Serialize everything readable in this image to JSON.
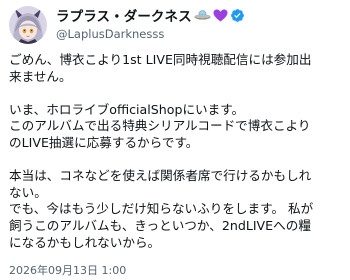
{
  "author": {
    "display_name": "ラプラス・ダークネス",
    "handle": "@LaplusDarknesss",
    "verified": true,
    "name_emojis": [
      "ufo-emoji",
      "purple-heart-emoji"
    ],
    "verified_color": "#1d9bf0"
  },
  "tweet": {
    "paragraphs": [
      "ごめん、博衣こより1st LIVE同時視聴配信には参加出\n来ません。",
      "いま、ホロライブofficialShopにいます。\nこのアルバムで出る特典シリアルコードで博衣こより\nのLIVE抽選に応募するからです。",
      "本当は、コネなどを使えば関係者席で行けるかもしれ\nない。\nでも、今はもう少しだけ知らないふりをします。 私が\n飼うこのアルバムも、きっといつか、2ndLIVEへの糧\nになるかもしれないから。"
    ],
    "timestamp": "2026年09月13日 1:00"
  },
  "colors": {
    "text": "#0f1419",
    "secondary": "#536471",
    "heart": "#9b3fe0"
  }
}
